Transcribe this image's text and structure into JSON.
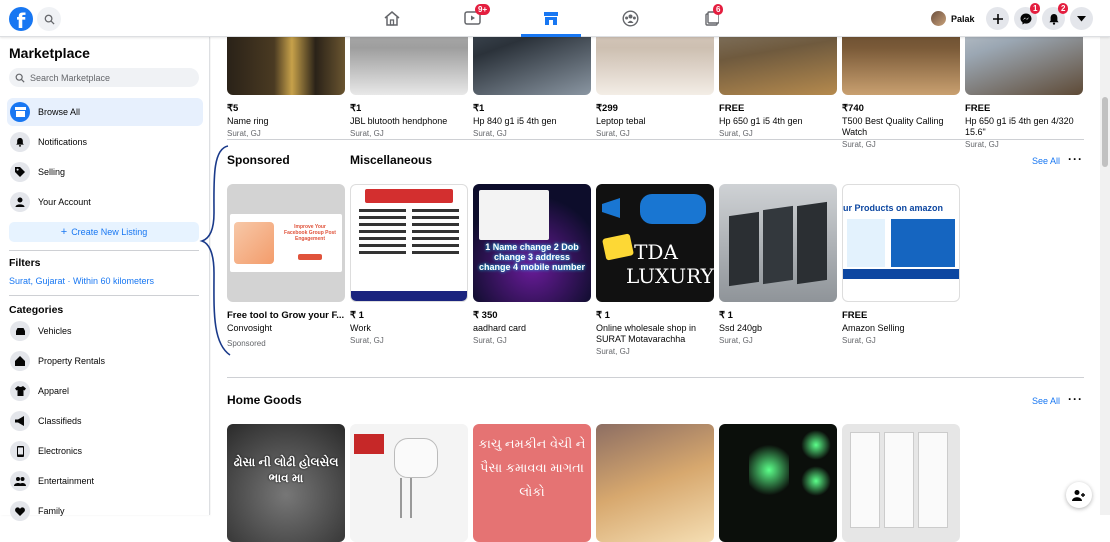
{
  "nav": {
    "logo_letter": "f",
    "badges": {
      "watch": "9+",
      "groups": "6",
      "messenger": "1",
      "notifications": "2"
    },
    "profile_name": "Palak",
    "icons": [
      "search-icon",
      "home-icon",
      "watch-icon",
      "marketplace-icon",
      "groups-icon",
      "gaming-icon",
      "plus-icon",
      "messenger-icon",
      "bell-icon",
      "caret-down-icon"
    ]
  },
  "sidebar": {
    "title": "Marketplace",
    "search_placeholder": "Search Marketplace",
    "items": [
      {
        "label": "Browse All",
        "icon": "storefront-icon",
        "active": true
      },
      {
        "label": "Notifications",
        "icon": "bell-icon"
      },
      {
        "label": "Selling",
        "icon": "tag-icon"
      },
      {
        "label": "Your Account",
        "icon": "person-icon"
      }
    ],
    "create_listing": "Create New Listing",
    "filters_heading": "Filters",
    "filter_location": "Surat, Gujarat · Within 60 kilometers",
    "categories_heading": "Categories",
    "categories": [
      {
        "label": "Vehicles",
        "icon": "car-icon"
      },
      {
        "label": "Property Rentals",
        "icon": "house-icon"
      },
      {
        "label": "Apparel",
        "icon": "shirt-icon"
      },
      {
        "label": "Classifieds",
        "icon": "megaphone-icon"
      },
      {
        "label": "Electronics",
        "icon": "phone-icon"
      },
      {
        "label": "Entertainment",
        "icon": "people-icon"
      },
      {
        "label": "Family",
        "icon": "heart-icon"
      }
    ]
  },
  "top_row": [
    {
      "price": "₹5",
      "title": "Name ring",
      "loc": "Surat, GJ"
    },
    {
      "price": "₹1",
      "title": "JBL blutooth hendphone",
      "loc": "Surat, GJ"
    },
    {
      "price": "₹1",
      "title": "Hp 840 g1 i5 4th gen",
      "loc": "Surat, GJ"
    },
    {
      "price": "₹299",
      "title": "Leptop tebal",
      "loc": "Surat, GJ"
    },
    {
      "price": "FREE",
      "title": "Hp 650 g1 i5 4th gen",
      "loc": "Surat, GJ"
    },
    {
      "price": "₹740",
      "title": "T500 Best Quality Calling Watch",
      "loc": "Surat, GJ"
    },
    {
      "price": "FREE",
      "title": "Hp 650 g1 i5 4th gen 4/320 15.6\"",
      "loc": "Surat, GJ"
    }
  ],
  "sponsored": {
    "heading": "Sponsored",
    "price": "Free tool to Grow your F...",
    "title": "Convosight",
    "loc": "Sponsored",
    "ad_headline": "Improve Your Facebook Group Post Engagement"
  },
  "misc": {
    "heading": "Miscellaneous",
    "see_all": "See All",
    "items": [
      {
        "price": "₹ 1",
        "title": "Work",
        "loc": "Surat, GJ"
      },
      {
        "price": "₹ 350",
        "title": "aadhard card",
        "loc": "Surat, GJ",
        "img_text": "1 Name change 2 Dob change 3 address change 4 mobile number"
      },
      {
        "price": "₹ 1",
        "title": "Online wholesale shop in SURAT Motavarachha",
        "loc": "Surat, GJ",
        "img_text": "TDA LUXURY"
      },
      {
        "price": "₹ 1",
        "title": "Ssd 240gb",
        "loc": "Surat, GJ"
      },
      {
        "price": "FREE",
        "title": "Amazon Selling",
        "loc": "Surat, GJ",
        "img_text": "ur Products on amazon"
      }
    ]
  },
  "home_goods": {
    "heading": "Home Goods",
    "see_all": "See All",
    "img_texts": [
      "ઢોસા ની લોઢી હોલસેલ ભાવ મા",
      "કાચુ નમકીન વેચી ને પૈસા કમાવવા માગતા લોકો"
    ]
  },
  "colors": {
    "accent": "#1877f2",
    "badge": "#e41e3f",
    "active_bg": "#e7f0fd",
    "brace": "#1a3a8a"
  }
}
